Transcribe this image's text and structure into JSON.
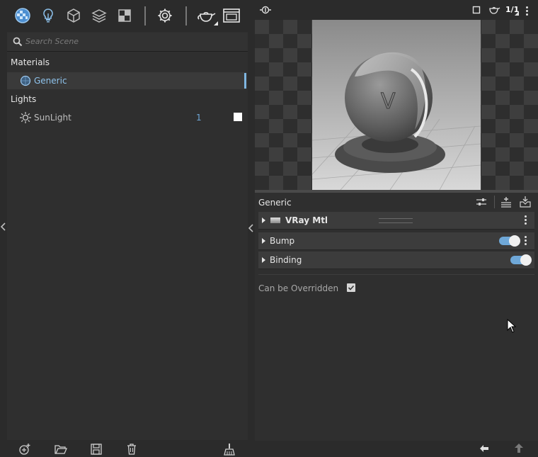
{
  "toolbar": {
    "icons": [
      "materials-icon",
      "lights-icon",
      "geometry-icon",
      "layers-icon",
      "textures-icon",
      "settings-icon",
      "render-teapot-icon",
      "frame-buffer-icon"
    ]
  },
  "search": {
    "placeholder": "Search Scene"
  },
  "materials": {
    "heading": "Materials",
    "items": [
      {
        "label": "Generic"
      }
    ]
  },
  "lights": {
    "heading": "Lights",
    "items": [
      {
        "label": "SunLight",
        "count": "1"
      }
    ]
  },
  "viewport": {
    "page_counter": "1/1"
  },
  "properties": {
    "title": "Generic",
    "rollouts": [
      {
        "label": "VRay Mtl"
      },
      {
        "label": "Bump"
      },
      {
        "label": "Binding"
      }
    ],
    "override_label": "Can be Overridden"
  },
  "colors": {
    "accent": "#6fa8d8",
    "panel": "#2f2f2f"
  }
}
